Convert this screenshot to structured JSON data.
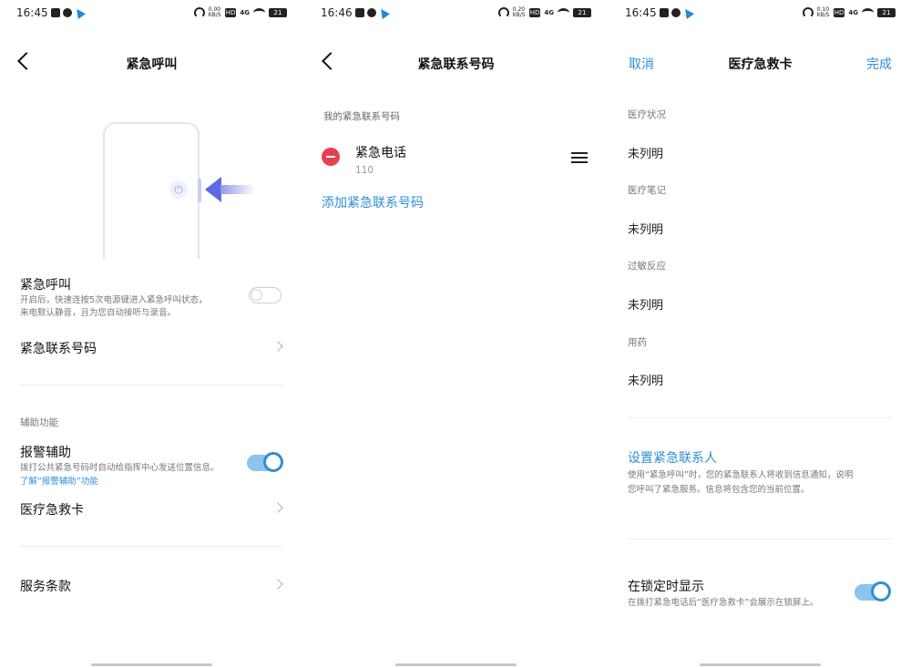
{
  "screens": [
    {
      "status": {
        "time": "16:45",
        "speed": "0.00 KB/S",
        "network": "4G",
        "battery": "21"
      },
      "nav": {
        "title": "紧急呼叫"
      },
      "emergency_call": {
        "title": "紧急呼叫",
        "desc_line1": "开启后，快速连按5次电源键进入紧急呼叫状态，",
        "desc_line2": "来电默认静音，且为您自动接听与录音。",
        "enabled": false
      },
      "emergency_contacts_label": "紧急联系号码",
      "section_label": "辅助功能",
      "alarm_assist": {
        "title": "报警辅助",
        "desc": "拨打公共紧急号码时自动给指挥中心发送位置信息。",
        "link": "了解“报警辅助”功能",
        "enabled": true
      },
      "medical_card_label": "医疗急救卡",
      "terms_label": "服务条款"
    },
    {
      "status": {
        "time": "16:46",
        "speed": "0.20 KB/S",
        "network": "4G",
        "battery": "21"
      },
      "nav": {
        "title": "紧急联系号码"
      },
      "section_label": "我的紧急联系号码",
      "contacts": [
        {
          "name": "紧急电话",
          "number": "110"
        }
      ],
      "add_link": "添加紧急联系号码"
    },
    {
      "status": {
        "time": "16:45",
        "speed": "0.10 KB/S",
        "network": "4G",
        "battery": "21"
      },
      "nav": {
        "title": "医疗急救卡",
        "cancel": "取消",
        "done": "完成"
      },
      "fields": [
        {
          "label": "医疗状况",
          "value": "未列明"
        },
        {
          "label": "医疗笔记",
          "value": "未列明"
        },
        {
          "label": "过敏反应",
          "value": "未列明"
        },
        {
          "label": "用药",
          "value": "未列明"
        }
      ],
      "set_contact_link": "设置紧急联系人",
      "set_contact_desc": "使用“紧急呼叫”时，您的紧急联系人将收到信息通知，说明您呼叫了紧急服务。信息将包含您的当前位置。",
      "lock_display": {
        "title": "在锁定时显示",
        "desc": "在拨打紧急电话后“医疗急救卡”会展示在锁屏上。",
        "enabled": true
      }
    }
  ],
  "colors": {
    "accent": "#2e8fd6",
    "danger": "#e5414f"
  },
  "icons": [
    "back-arrow-icon",
    "power-icon",
    "chevron-right-icon",
    "minus-circle-icon",
    "drag-handle-icon"
  ]
}
